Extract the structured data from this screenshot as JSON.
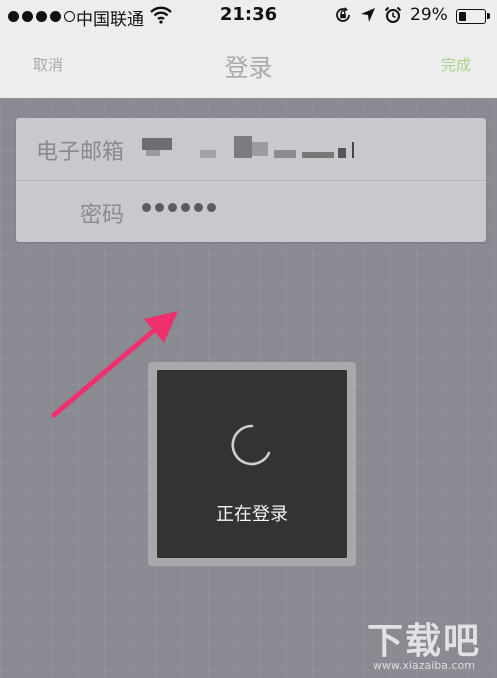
{
  "status_bar": {
    "carrier": "中国联通",
    "time": "21:36",
    "battery_percent": "29%",
    "signal_bars_filled": 4,
    "signal_bars_total": 5,
    "battery_level": 0.29
  },
  "nav": {
    "left_label": "取消",
    "title": "登录",
    "right_label": "完成",
    "right_color": "#a8d38a"
  },
  "form": {
    "email_label": "电子邮箱",
    "password_label": "密码",
    "password_mask": "••••••"
  },
  "hud": {
    "text": "正在登录"
  },
  "annotation": {
    "arrow_color": "#f0306e"
  },
  "watermark": {
    "logo": "下载吧",
    "url": "www.xiazaiba.com"
  },
  "icons": [
    "wifi-icon",
    "rotation-lock-icon",
    "location-arrow-icon",
    "alarm-icon",
    "battery-icon",
    "spinner-icon"
  ]
}
